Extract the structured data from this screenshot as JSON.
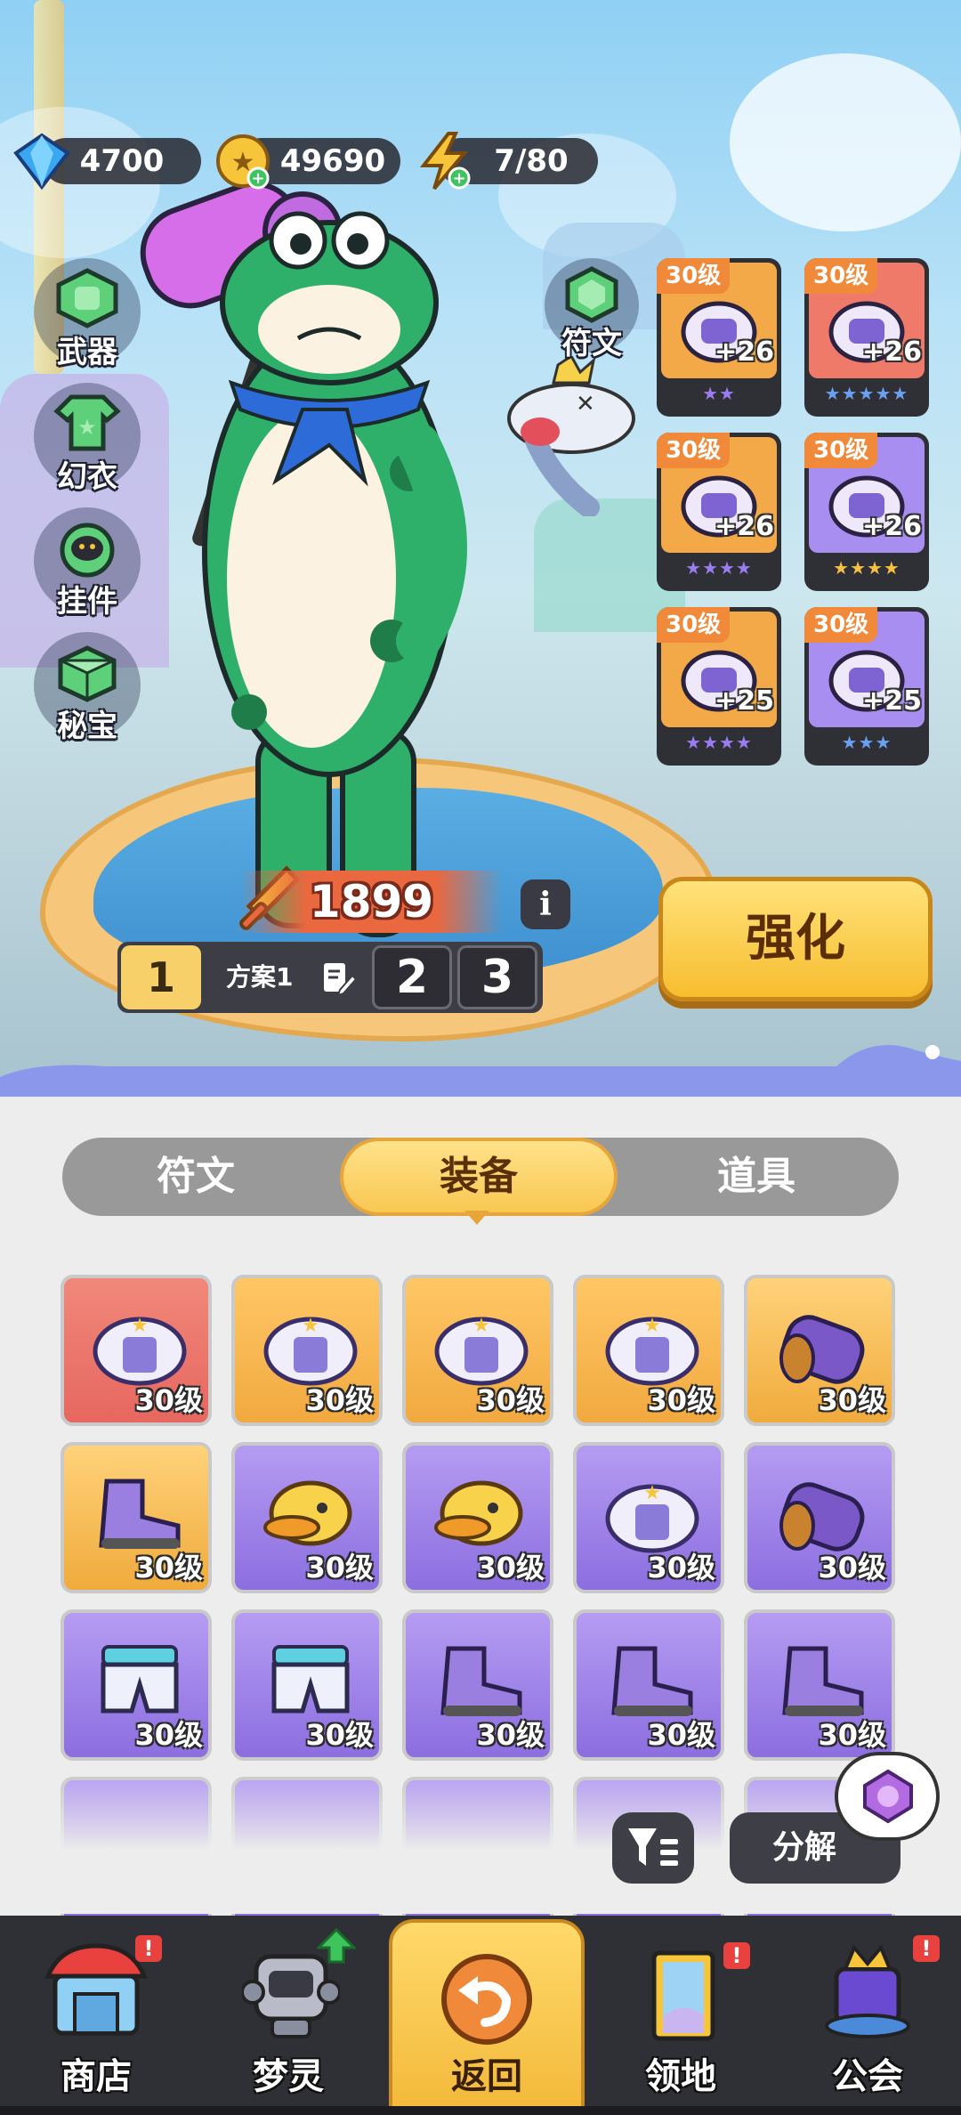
{
  "currency": {
    "diamonds": "4700",
    "coins": "49690",
    "energy": "7/80"
  },
  "side_menu": {
    "weapon": "武器",
    "costume": "幻衣",
    "pendant": "挂件",
    "treasure": "秘宝"
  },
  "rune_button": "符文",
  "equipped_slots": [
    {
      "level": "30级",
      "plus": "+26",
      "stars": "★★",
      "bg": "#f3a947",
      "star_color": "#9b7cf0"
    },
    {
      "level": "30级",
      "plus": "+26",
      "stars": "★★★★★",
      "bg": "#f07a6a",
      "star_color": "#6aa0f0"
    },
    {
      "level": "30级",
      "plus": "+26",
      "stars": "★★★★",
      "bg": "#f3a947",
      "star_color": "#9b7cf0"
    },
    {
      "level": "30级",
      "plus": "+26",
      "stars": "★★★★",
      "bg": "#a78ef0",
      "star_color": "#f5c043"
    },
    {
      "level": "30级",
      "plus": "+25",
      "stars": "★★★★",
      "bg": "#f3a947",
      "star_color": "#9b7cf0"
    },
    {
      "level": "30级",
      "plus": "+25",
      "stars": "★★★",
      "bg": "#a78ef0",
      "star_color": "#6aa0f0"
    }
  ],
  "power": "1899",
  "plans": {
    "active_number": "1",
    "active_name": "方案1",
    "other": [
      "2",
      "3"
    ]
  },
  "strengthen_button": "强化",
  "tabs": [
    "符文",
    "装备",
    "道具"
  ],
  "active_tab": "装备",
  "inventory": [
    {
      "level": "30级",
      "bg": "red",
      "icon": "jacket-icon"
    },
    {
      "level": "30级",
      "bg": "orange",
      "icon": "jacket-icon"
    },
    {
      "level": "30级",
      "bg": "orange",
      "icon": "jacket-icon"
    },
    {
      "level": "30级",
      "bg": "orange",
      "icon": "jacket-icon"
    },
    {
      "level": "30级",
      "bg": "gold",
      "icon": "gauntlet-icon"
    },
    {
      "level": "30级",
      "bg": "gold",
      "icon": "shoe-icon"
    },
    {
      "level": "30级",
      "bg": "purple",
      "icon": "duck-helmet-icon"
    },
    {
      "level": "30级",
      "bg": "purple",
      "icon": "duck-helmet-icon"
    },
    {
      "level": "30级",
      "bg": "purple",
      "icon": "jacket-icon"
    },
    {
      "level": "30级",
      "bg": "purple",
      "icon": "gauntlet-icon"
    },
    {
      "level": "30级",
      "bg": "purple",
      "icon": "pants-icon"
    },
    {
      "level": "30级",
      "bg": "purple",
      "icon": "pants-icon"
    },
    {
      "level": "30级",
      "bg": "purple",
      "icon": "shoe-icon"
    },
    {
      "level": "30级",
      "bg": "purple",
      "icon": "shoe-icon"
    },
    {
      "level": "30级",
      "bg": "purple",
      "icon": "shoe-icon"
    }
  ],
  "decompose_button": "分解",
  "nav": {
    "shop": "商店",
    "dream_spirit": "梦灵",
    "back": "返回",
    "territory": "领地",
    "guild": "公会",
    "badge": "!"
  },
  "colors": {
    "accent_yellow": "#f7c94c",
    "panel_bg": "#ededed",
    "nav_bg": "#2f2f36",
    "level_tag": "#f08a3a"
  }
}
